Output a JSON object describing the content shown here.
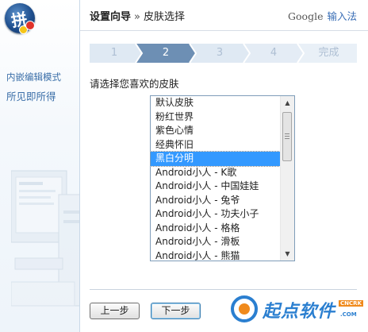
{
  "sidebar": {
    "links": [
      "内嵌编辑模式",
      "所见即所得"
    ],
    "logo_char": "拼"
  },
  "header": {
    "title_main": "设置向导",
    "separator": "»",
    "title_sub": "皮肤选择",
    "brand_google": "Google",
    "brand_ime": "输入法"
  },
  "steps": {
    "items": [
      "1",
      "2",
      "3",
      "4",
      "完成"
    ],
    "current_index": 1,
    "active_color": "#6d8fb4",
    "inactive_color": "#dfe9f3"
  },
  "content": {
    "prompt": "请选择您喜欢的皮肤",
    "skins": [
      "默认皮肤",
      "粉红世界",
      "紫色心情",
      "经典怀旧",
      "黑白分明",
      "Android小人 - K歌",
      "Android小人 - 中国娃娃",
      "Android小人 - 兔爷",
      "Android小人 - 功夫小子",
      "Android小人 - 格格",
      "Android小人 - 滑板",
      "Android小人 - 熊猫"
    ],
    "selected_index": 4
  },
  "buttons": {
    "prev": "上一步",
    "next": "下一步"
  },
  "watermark": {
    "text": "起点软件",
    "badge": "CNCRK",
    "domain": ".COM"
  },
  "icons": {
    "logo": "pinyin-logo-icon",
    "scroll_up": "arrow-up-icon",
    "scroll_down": "arrow-down-icon"
  }
}
